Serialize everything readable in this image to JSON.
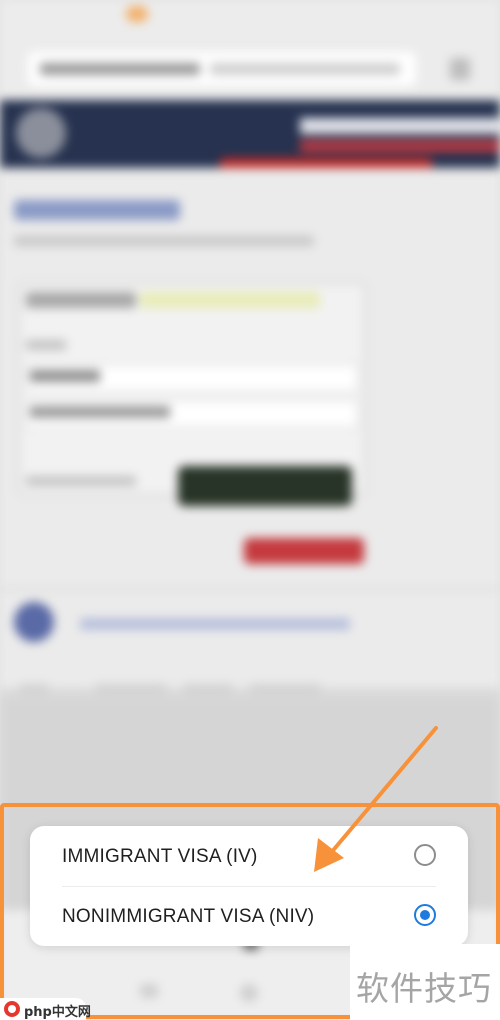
{
  "dialog": {
    "options": [
      {
        "label": "IMMIGRANT VISA (IV)",
        "selected": false
      },
      {
        "label": "NONIMMIGRANT VISA (NIV)",
        "selected": true
      }
    ]
  },
  "watermark": {
    "right_text": "软件技巧",
    "left_text": "php中文网"
  },
  "colors": {
    "highlight": "#f7923a",
    "radio_selected": "#1f7ae0",
    "radio_unselected": "#8d8d8d",
    "arrow": "#f7923a"
  }
}
